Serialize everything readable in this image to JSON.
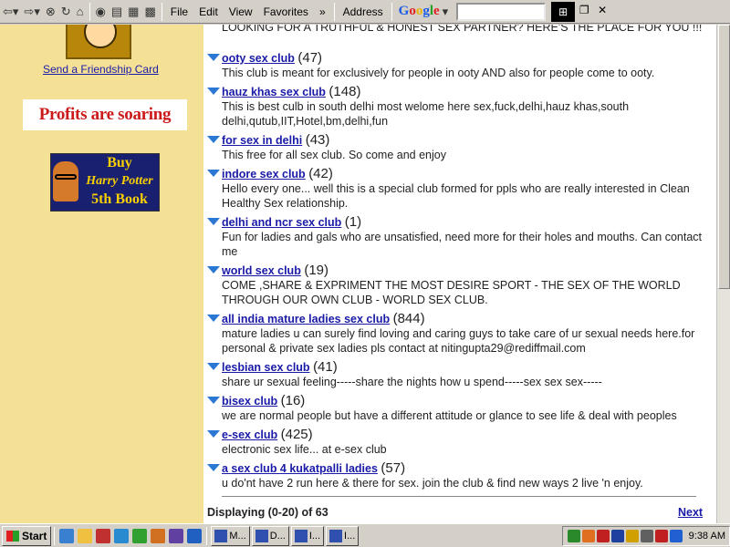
{
  "toolbar": {
    "menus": [
      "File",
      "Edit",
      "View",
      "Favorites"
    ],
    "chevron": "»",
    "address_label": "Address",
    "google_label": "Google",
    "google_letters": [
      "G",
      "o",
      "o",
      "g",
      "l",
      "e"
    ]
  },
  "sidebar": {
    "friendship_link": "Send a Friendship Card",
    "profits_ad": "Profits are soaring",
    "hp_ad_lines": [
      "Buy",
      "Harry Potter",
      "5th Book"
    ]
  },
  "main": {
    "banner": "LOOKING FOR A TRUTHFUL & HONEST SEX PARTNER? HERE'S THE PLACE FOR YOU !!!",
    "clubs": [
      {
        "name": "ooty sex club",
        "count": "(47)",
        "desc": "This club is meant for exclusively for people in ooty AND also for people come to ooty."
      },
      {
        "name": "hauz khas sex club",
        "count": "(148)",
        "desc": "This is best culb in south delhi most welome here sex,fuck,delhi,hauz khas,south delhi,qutub,IIT,Hotel,bm,delhi,fun"
      },
      {
        "name": "for sex in delhi",
        "count": "(43)",
        "desc": "This free for all sex club. So come and enjoy"
      },
      {
        "name": "indore sex club",
        "count": "(42)",
        "desc": "Hello every one... well this is a special club formed for ppls who are really interested in Clean Healthy Sex relationship."
      },
      {
        "name": "delhi and ncr sex club",
        "count": "(1)",
        "desc": "Fun for ladies and gals who are unsatisfied, need more for their holes and mouths. Can contact me"
      },
      {
        "name": "world sex club",
        "count": "(19)",
        "desc": "COME ,SHARE & EXPRIMENT THE MOST DESIRE SPORT - THE SEX OF THE WORLD THROUGH OUR OWN CLUB - WORLD SEX CLUB."
      },
      {
        "name": "all india mature ladies sex club",
        "count": "(844)",
        "desc": "mature ladies u can surely find loving and caring guys to take care of ur sexual needs here.for personal & private sex ladies pls contact at nitingupta29@rediffmail.com"
      },
      {
        "name": "lesbian sex club",
        "count": "(41)",
        "desc": "share ur sexual feeling-----share the nights how u spend-----sex sex sex-----"
      },
      {
        "name": "bisex club",
        "count": "(16)",
        "desc": "we are normal people but have a different attitude or glance to see life & deal with peoples"
      },
      {
        "name": "e-sex club",
        "count": "(425)",
        "desc": "electronic sex life... at e-sex club"
      },
      {
        "name": "a sex club 4 kukatpalli ladies",
        "count": "(57)",
        "desc": "u do'nt have 2 run here & there for sex. join the club & find new ways 2 live 'n enjoy."
      }
    ],
    "displaying": "Displaying (0-20) of 63",
    "next_label": "Next"
  },
  "taskbar": {
    "start_label": "Start",
    "tasks": [
      "M...",
      "D...",
      "I...",
      "I..."
    ],
    "clock": "9:38 AM"
  }
}
